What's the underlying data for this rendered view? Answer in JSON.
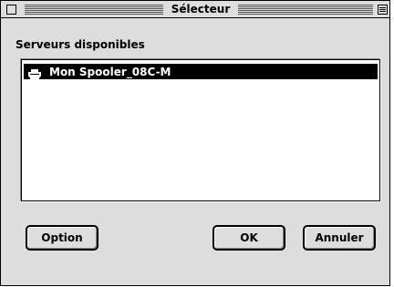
{
  "window": {
    "title": "Sélecteur"
  },
  "section": {
    "label": "Serveurs disponibles"
  },
  "servers": [
    {
      "name": "Mon Spooler_08C-M",
      "icon": "printer-icon",
      "selected": true
    }
  ],
  "buttons": {
    "option": "Option",
    "ok": "OK",
    "cancel": "Annuler"
  },
  "colors": {
    "window_bg": "#dddddd",
    "selection_bg": "#000000",
    "selection_fg": "#ffffff"
  }
}
